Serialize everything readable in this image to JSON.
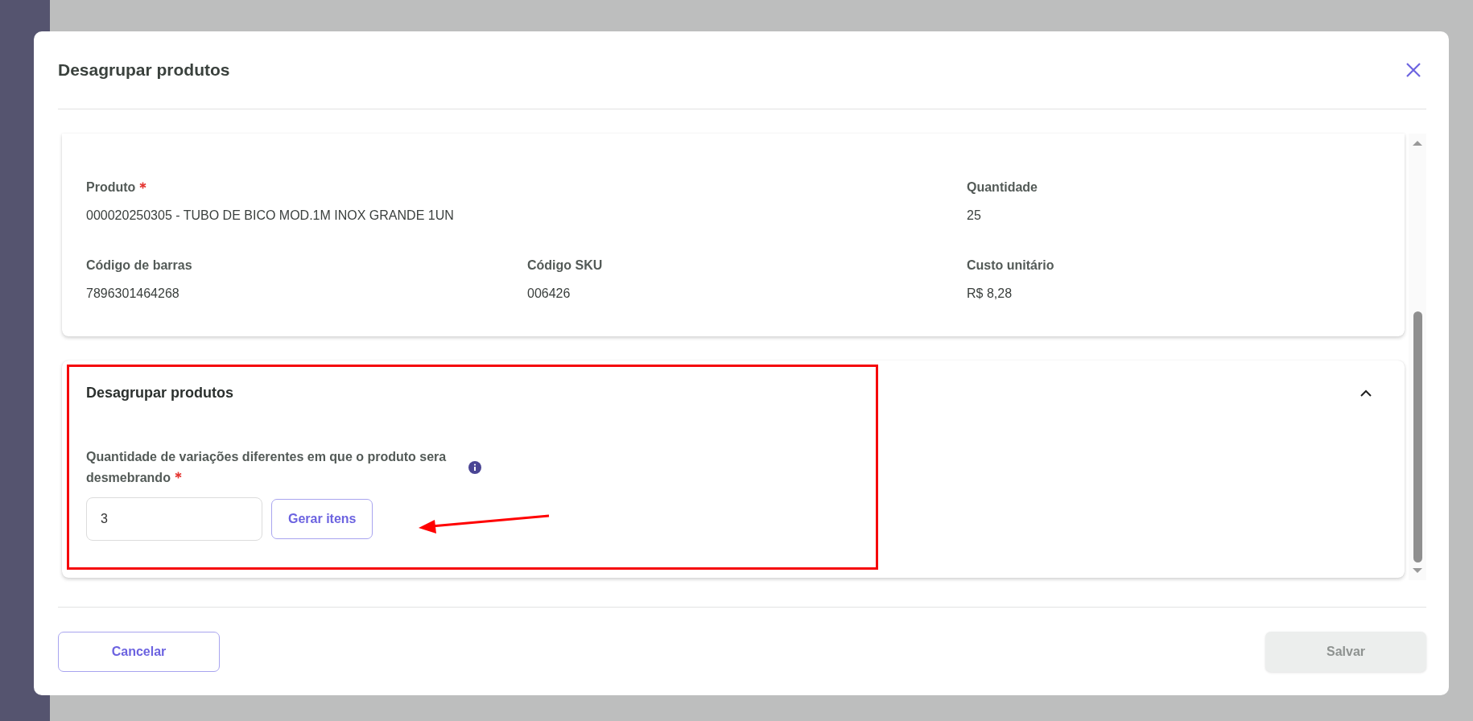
{
  "dialog": {
    "title": "Desagrupar produtos"
  },
  "product_card": {
    "rows": [
      [
        {
          "label": "Produto",
          "required": true,
          "value": "000020250305 - TUBO DE BICO MOD.1M INOX GRANDE 1UN"
        },
        null,
        {
          "label": "Quantidade",
          "required": false,
          "value": "25"
        }
      ],
      [
        {
          "label": "Código de barras",
          "required": false,
          "value": "7896301464268"
        },
        {
          "label": "Código SKU",
          "required": false,
          "value": "006426"
        },
        {
          "label": "Custo unitário",
          "required": false,
          "value": "R$ 8,28"
        }
      ]
    ]
  },
  "unbundle_section": {
    "title": "Desagrupar produtos",
    "expanded": true,
    "field": {
      "label": "Quantidade de variações diferentes em que o produto sera desmebrando",
      "required": true,
      "value": "3"
    },
    "button": "Gerar itens"
  },
  "footer": {
    "cancel": "Cancelar",
    "save": {
      "label": "Salvar",
      "disabled": true
    }
  }
}
